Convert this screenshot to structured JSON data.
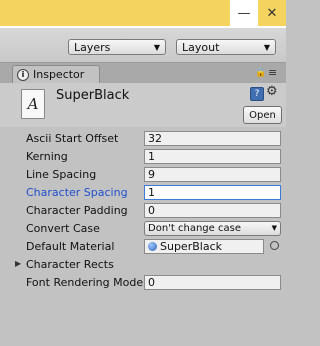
{
  "window": {
    "minimize_glyph": "—",
    "close_glyph": "✕"
  },
  "toolbar": {
    "layers_label": "Layers",
    "layout_label": "Layout"
  },
  "tab": {
    "label": "Inspector"
  },
  "header": {
    "title": "SuperBlack",
    "open_label": "Open",
    "asset_icon_glyph": "A"
  },
  "properties": [
    {
      "label": "Ascii Start Offset",
      "value": "32"
    },
    {
      "label": "Kerning",
      "value": "1"
    },
    {
      "label": "Line Spacing",
      "value": "9"
    },
    {
      "label": "Character Spacing",
      "value": "1"
    },
    {
      "label": "Character Padding",
      "value": "0"
    },
    {
      "label": "Convert Case",
      "value": "Don't change case"
    },
    {
      "label": "Default Material",
      "value": "SuperBlack"
    },
    {
      "label": "Character Rects"
    },
    {
      "label": "Font Rendering Mode",
      "value": "0"
    }
  ],
  "colors": {
    "focus_blue": "#1e4fd0",
    "title_yellow": "#f4d35e"
  }
}
